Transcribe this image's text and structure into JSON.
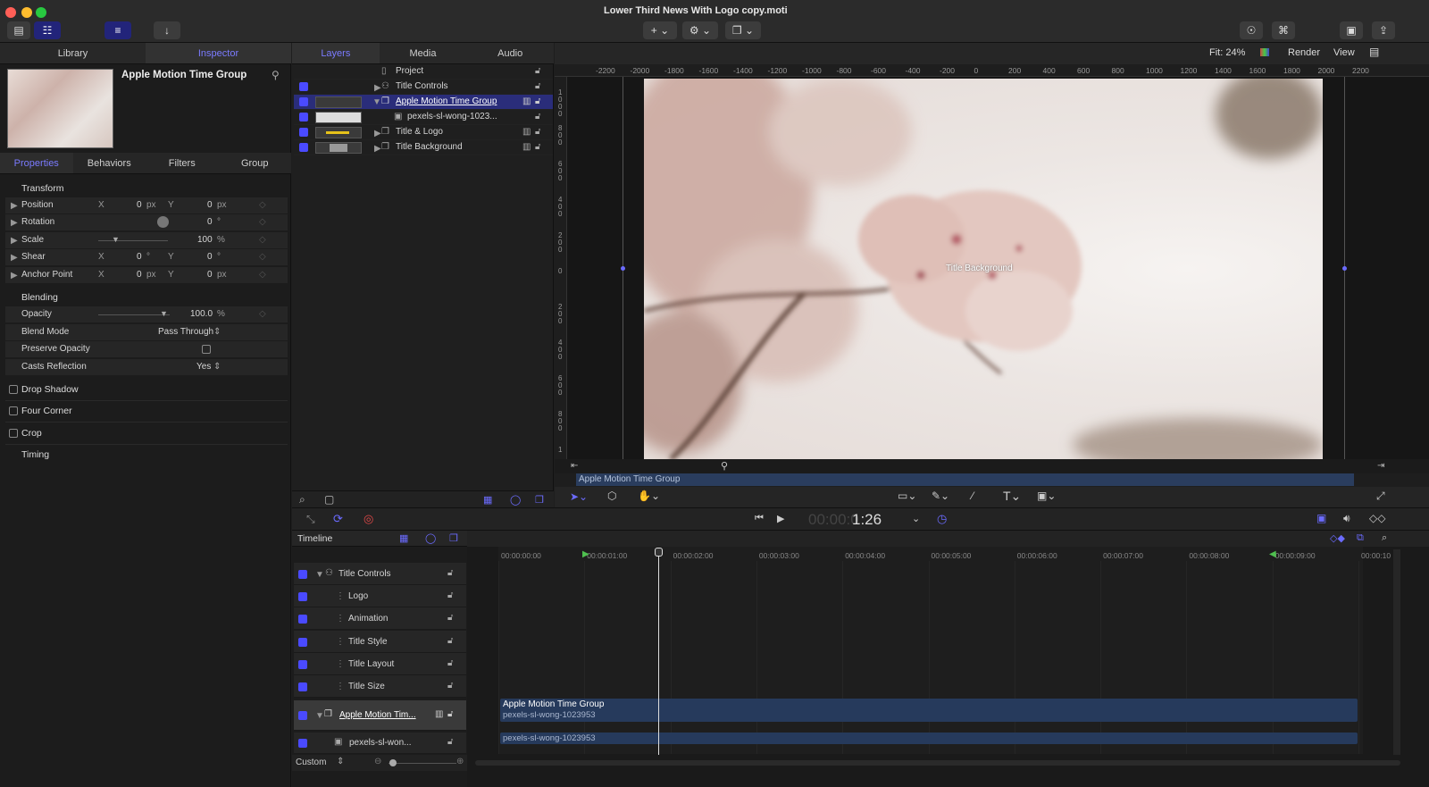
{
  "window": {
    "title": "Lower Third News With Logo copy.moti"
  },
  "left_tabs": [
    "Library",
    "Inspector"
  ],
  "inspector": {
    "title": "Apple Motion Time Group",
    "tabs": [
      "Properties",
      "Behaviors",
      "Filters",
      "Group"
    ],
    "transform_label": "Transform",
    "rows": [
      {
        "label": "Position",
        "x_lbl": "X",
        "x": "0",
        "xu": "px",
        "y_lbl": "Y",
        "y": "0",
        "yu": "px"
      },
      {
        "label": "Rotation",
        "x": "0",
        "xu": "°"
      },
      {
        "label": "Scale",
        "x": "100",
        "xu": "%"
      },
      {
        "label": "Shear",
        "x_lbl": "X",
        "x": "0",
        "xu": "°",
        "y_lbl": "Y",
        "y": "0",
        "yu": "°"
      },
      {
        "label": "Anchor Point",
        "x_lbl": "X",
        "x": "0",
        "xu": "px",
        "y_lbl": "Y",
        "y": "0",
        "yu": "px"
      }
    ],
    "blending_label": "Blending",
    "opacity_label": "Opacity",
    "opacity": "100.0",
    "opacity_unit": "%",
    "blend_mode_label": "Blend Mode",
    "blend_mode": "Pass Through",
    "preserve_opacity_label": "Preserve Opacity",
    "casts_reflection_label": "Casts Reflection",
    "casts_reflection": "Yes",
    "drop_shadow": "Drop Shadow",
    "four_corner": "Four Corner",
    "crop": "Crop",
    "timing": "Timing"
  },
  "middle_tabs": [
    "Layers",
    "Media",
    "Audio"
  ],
  "layers": [
    "Project",
    "Title Controls",
    "Apple Motion Time Group",
    "pexels-sl-wong-1023...",
    "Title & Logo",
    "Title Background"
  ],
  "canvas": {
    "fit": "Fit: 24%",
    "render": "Render",
    "view": "View",
    "overlay_label": "Title Background",
    "mini_timeline_label": "Apple Motion Time Group",
    "ruler_h": [
      "-2200",
      "-2000",
      "-1800",
      "-1600",
      "-1400",
      "-1200",
      "-1000",
      "-800",
      "-600",
      "-400",
      "-200",
      "0",
      "200",
      "400",
      "600",
      "800",
      "1000",
      "1200",
      "1400",
      "1600",
      "1800",
      "2000",
      "2200"
    ],
    "ruler_v": [
      "1000",
      "800",
      "600",
      "400",
      "200",
      "0",
      "200",
      "400",
      "600",
      "800",
      "1"
    ]
  },
  "transport": {
    "timecode_dim": "00:00:0",
    "timecode": "1:26"
  },
  "timeline": {
    "label": "Timeline",
    "rows": [
      "Title Controls",
      "Logo",
      "Animation",
      "Title Style",
      "Title Layout",
      "Title Size",
      "Apple Motion Tim...",
      "pexels-sl-won..."
    ],
    "ticks": [
      "00:00:00:00",
      "00:00:01:00",
      "00:00:02:00",
      "00:00:03:00",
      "00:00:04:00",
      "00:00:05:00",
      "00:00:06:00",
      "00:00:07:00",
      "00:00:08:00",
      "00:00:09:00",
      "00:00:10"
    ],
    "clip1_title": "Apple Motion Time Group",
    "clip1_sub": "pexels-sl-wong-1023953",
    "clip2": "pexels-sl-wong-1023953",
    "zoom_label": "Custom"
  }
}
